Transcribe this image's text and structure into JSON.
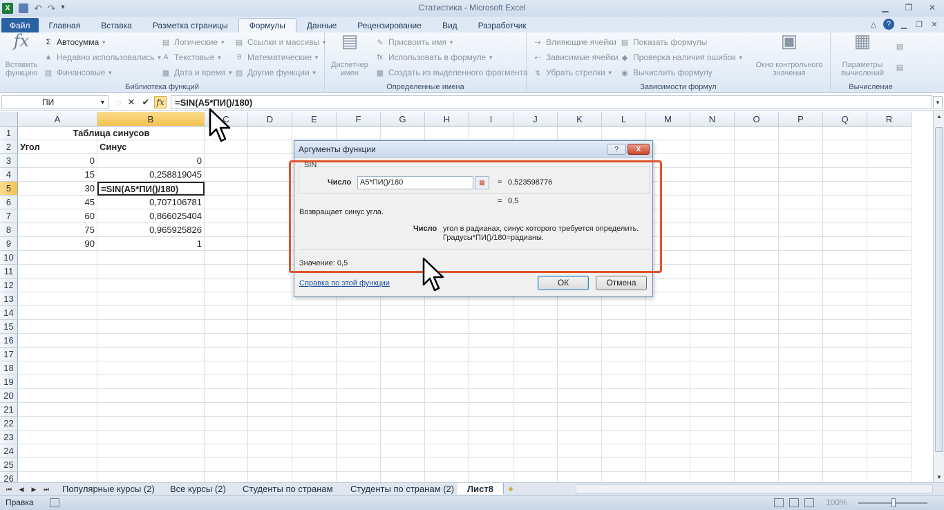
{
  "window": {
    "title": "Статистика - Microsoft Excel",
    "app_icon_label": "X"
  },
  "ribbon": {
    "file_tab": "Файл",
    "tabs": [
      "Главная",
      "Вставка",
      "Разметка страницы",
      "Формулы",
      "Данные",
      "Рецензирование",
      "Вид",
      "Разработчик"
    ],
    "active_tab": "Формулы",
    "groups": {
      "function_library": {
        "label": "Библиотека функций",
        "insert_function": "Вставить функцию",
        "autosum": "Автосумма",
        "recently_used": "Недавно использовались",
        "financial": "Финансовые",
        "logical": "Логические",
        "text": "Текстовые",
        "date_time": "Дата и время",
        "lookup": "Ссылки и массивы",
        "math": "Математические",
        "more": "Другие функции"
      },
      "defined_names": {
        "label": "Определенные имена",
        "name_manager": "Диспетчер имен",
        "assign_name": "Присвоить имя",
        "use_in_formula": "Использовать в формуле",
        "create_from_selection": "Создать из выделенного фрагмента"
      },
      "formula_auditing": {
        "label": "Зависимости формул",
        "trace_precedents": "Влияющие ячейки",
        "trace_dependents": "Зависимые ячейки",
        "remove_arrows": "Убрать стрелки",
        "show_formulas": "Показать формулы",
        "error_checking": "Проверка наличия ошибок",
        "evaluate_formula": "Вычислить формулу",
        "watch_window": "Окно контрольного значения"
      },
      "calculation": {
        "label": "Вычисление",
        "calc_options": "Параметры вычислений"
      }
    }
  },
  "formula_bar": {
    "name_box": "ПИ",
    "formula": "=SIN(A5*ПИ()/180)"
  },
  "sheet": {
    "columns": [
      "A",
      "B",
      "C",
      "D",
      "E",
      "F",
      "G",
      "H",
      "I",
      "J",
      "K",
      "L",
      "M",
      "N",
      "O",
      "P",
      "Q",
      "R"
    ],
    "selected_column": "B",
    "selected_row": 5,
    "rows": 26,
    "cells": {
      "title": "Таблица синусов",
      "header_angle": "Угол",
      "header_sine": "Синус",
      "angles": [
        "0",
        "15",
        "30",
        "45",
        "60",
        "75",
        "90"
      ],
      "sines": [
        "0",
        "0,258819045",
        "=SIN(A5*ПИ()/180)",
        "0,707106781",
        "0,866025404",
        "0,965925826",
        "1"
      ]
    }
  },
  "sheet_tabs": [
    "Популярные курсы (2)",
    "Все курсы (2)",
    "Студенты по странам",
    "Студенты по странам (2)",
    "Лист8"
  ],
  "active_sheet": "Лист8",
  "status_bar": {
    "mode": "Правка",
    "zoom": "100%"
  },
  "dialog": {
    "title": "Аргументы функции",
    "help_btn": "?",
    "close_btn": "X",
    "function_name": "SIN",
    "arg_label": "Число",
    "arg_value": "A5*ПИ()/180",
    "arg_eq": "=",
    "arg_result": "0,523598776",
    "result_eq": "=",
    "result": "0,5",
    "description": "Возвращает синус угла.",
    "arg_help_name": "Число",
    "arg_help_line1": "угол в радианах, синус которого требуется определить.",
    "arg_help_line2": "Градусы*ПИ()/180=радианы.",
    "value_text": "Значение:  0,5",
    "help_link": "Справка по этой функции",
    "ok": "ОК",
    "cancel": "Отмена"
  },
  "colors": {
    "file_tab": "#2a61a5",
    "selection_header": "#f4c24f",
    "highlight_border": "#e2532b",
    "excel_green": "#1f7a3a"
  }
}
